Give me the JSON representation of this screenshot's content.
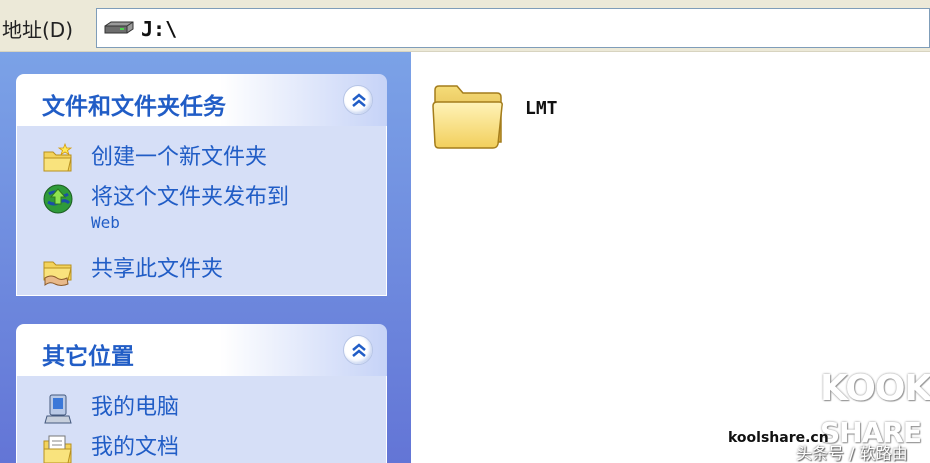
{
  "address_bar": {
    "label": "地址(D)",
    "path": "J:\\",
    "icon": "drive-icon"
  },
  "task_pane": {
    "file_tasks": {
      "title": "文件和文件夹任务",
      "items": [
        {
          "label": "创建一个新文件夹",
          "icon": "new-folder-icon"
        },
        {
          "label": "将这个文件夹发布到",
          "label_line2": "Web",
          "icon": "publish-web-icon"
        },
        {
          "label": "共享此文件夹",
          "icon": "share-folder-icon"
        }
      ]
    },
    "other_places": {
      "title": "其它位置",
      "items": [
        {
          "label": "我的电脑",
          "icon": "my-computer-icon"
        },
        {
          "label": "我的文档",
          "icon": "my-documents-icon"
        }
      ]
    },
    "colors": {
      "pane_bg": "#7ba2e7",
      "header_text": "#215dc6",
      "body_bg": "#d6dff7"
    }
  },
  "files": [
    {
      "name": "LMT",
      "icon": "folder-icon"
    }
  ],
  "watermark": {
    "logo_top": "KOOK",
    "logo_bottom": "SHARE",
    "site": "koolshare.cn",
    "sub": "头条号 / 软路由"
  }
}
